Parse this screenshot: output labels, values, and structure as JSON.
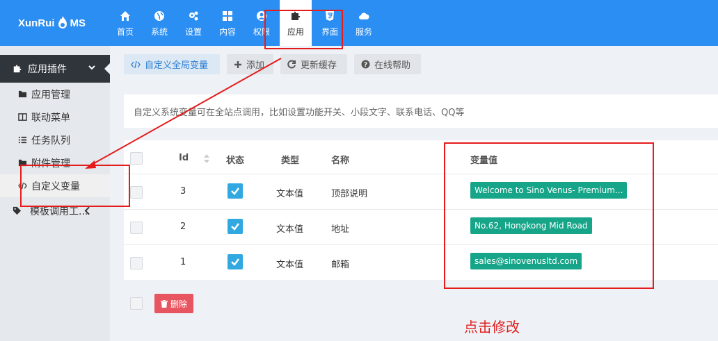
{
  "brand": {
    "logo_text_left": "XunRui",
    "logo_text_right": "MS"
  },
  "nav": [
    {
      "label": "首页",
      "icon": "home-icon"
    },
    {
      "label": "系统",
      "icon": "globe-icon"
    },
    {
      "label": "设置",
      "icon": "cogs-icon"
    },
    {
      "label": "内容",
      "icon": "grid-icon"
    },
    {
      "label": "权限",
      "icon": "user-icon"
    },
    {
      "label": "应用",
      "icon": "puzzle-icon",
      "active": true
    },
    {
      "label": "界面",
      "icon": "html5-icon"
    },
    {
      "label": "服务",
      "icon": "cloud-icon"
    }
  ],
  "sidebar": {
    "header": "应用插件",
    "items": [
      {
        "label": "应用管理",
        "icon": "folder-icon"
      },
      {
        "label": "联动菜单",
        "icon": "columns-icon"
      },
      {
        "label": "任务队列",
        "icon": "list-icon"
      },
      {
        "label": "附件管理",
        "icon": "folder-icon"
      },
      {
        "label": "自定义变量",
        "icon": "code-icon",
        "active": true
      },
      {
        "label": "模板调用工...",
        "icon": "tag-icon"
      }
    ]
  },
  "toolbar": {
    "custom_vars": "自定义全局变量",
    "add": "添加",
    "refresh_cache": "更新缓存",
    "online_help": "在线帮助"
  },
  "info_text": "自定义系统变量可在全站点调用，比如设置功能开关、小段文字、联系电话、QQ等",
  "table": {
    "headers": {
      "id": "Id",
      "status": "状态",
      "type": "类型",
      "name": "名称",
      "value": "变量值"
    },
    "rows": [
      {
        "id": "3",
        "type": "文本值",
        "name": "顶部说明",
        "value": "Welcome to Sino Venus- Premium..."
      },
      {
        "id": "2",
        "type": "文本值",
        "name": "地址",
        "value": "No.62, Hongkong Mid Road"
      },
      {
        "id": "1",
        "type": "文本值",
        "name": "邮箱",
        "value": "sales@sinovenusltd.com"
      }
    ]
  },
  "delete_label": "删除",
  "annotation": "点击修改",
  "colors": {
    "topbar": "#2b8ef2",
    "tag": "#17a589",
    "delete": "#e75560",
    "annotation": "#e02020",
    "status": "#32a8e0"
  }
}
